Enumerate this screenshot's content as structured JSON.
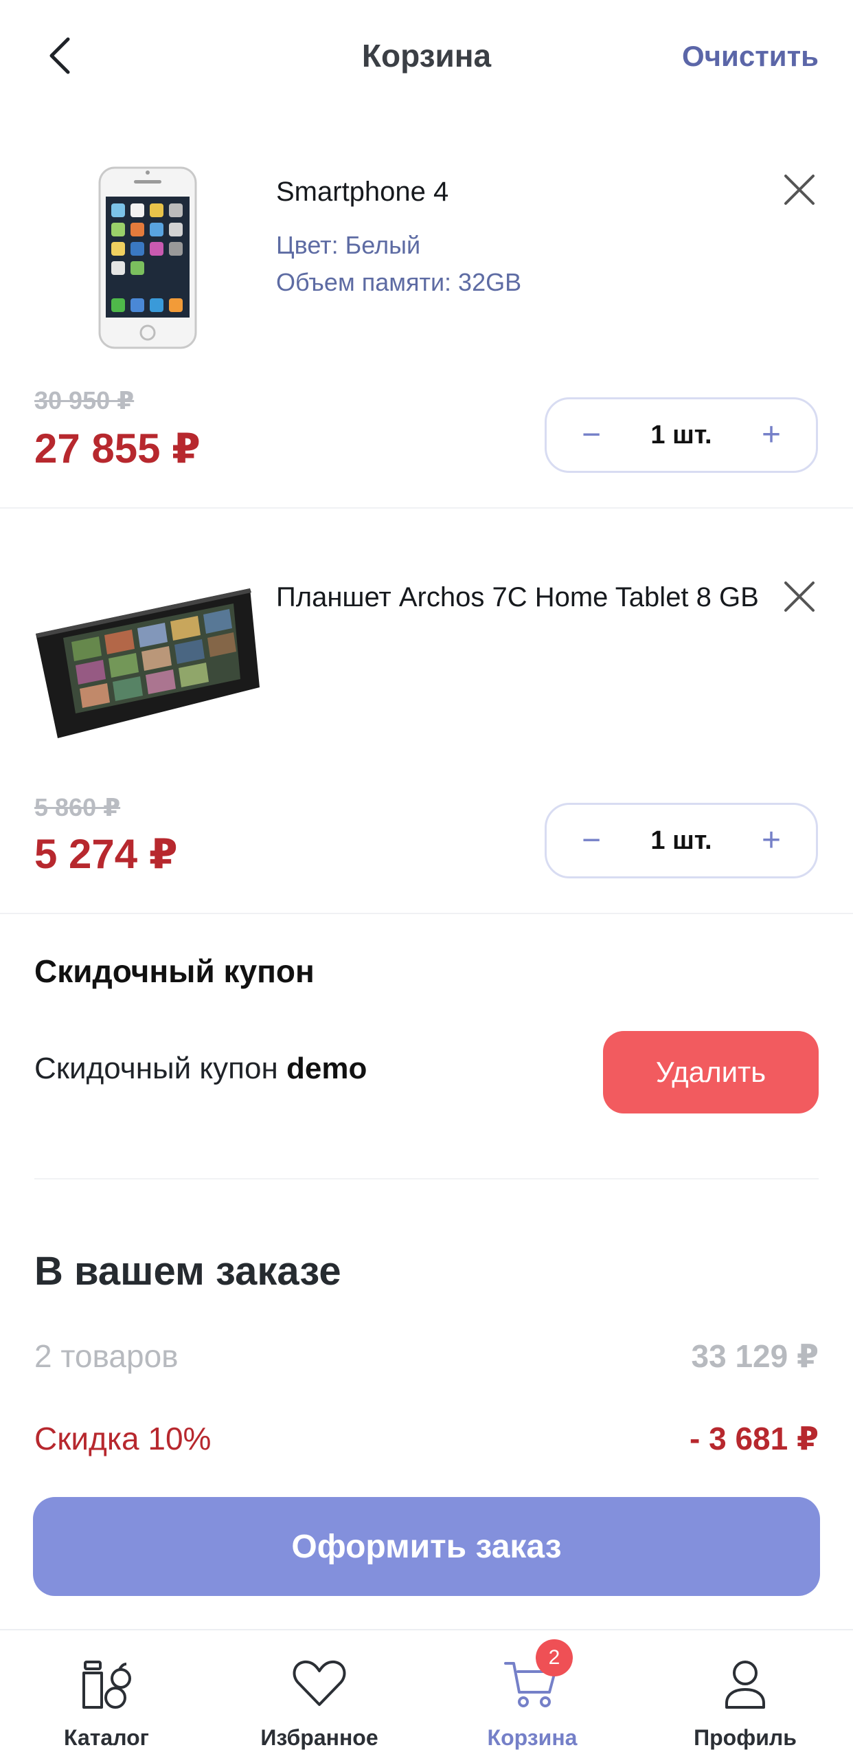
{
  "header": {
    "title": "Корзина",
    "clear_label": "Очистить"
  },
  "cart_items": [
    {
      "title": "Smartphone 4",
      "attributes": [
        "Цвет: Белый",
        "Объем памяти: 32GB"
      ],
      "old_price": "30 950 ₽",
      "price": "27 855 ₽",
      "quantity": "1 шт."
    },
    {
      "title": "Планшет Archos 7C Home Tablet 8 GB",
      "attributes": [],
      "old_price": "5 860 ₽",
      "price": "5 274 ₽",
      "quantity": "1 шт."
    }
  ],
  "coupon": {
    "section_title": "Скидочный купон",
    "text_prefix": "Скидочный купон",
    "code": "demo",
    "delete_label": "Удалить"
  },
  "order": {
    "title": "В вашем заказе",
    "items_label": "2 товаров",
    "items_total": "33 129 ₽",
    "discount_label": "Скидка 10%",
    "discount_value": "- 3 681 ₽",
    "checkout_label": "Оформить заказ"
  },
  "tabbar": {
    "tabs": [
      {
        "label": "Каталог",
        "icon": "catalog-icon"
      },
      {
        "label": "Избранное",
        "icon": "heart-icon"
      },
      {
        "label": "Корзина",
        "icon": "cart-icon"
      },
      {
        "label": "Профиль",
        "icon": "profile-icon"
      }
    ],
    "cart_badge": "2"
  },
  "colors": {
    "accent": "#7580c8",
    "price": "#b7282e",
    "delete_button": "#f25b5f",
    "checkout_button": "#8390dc"
  }
}
